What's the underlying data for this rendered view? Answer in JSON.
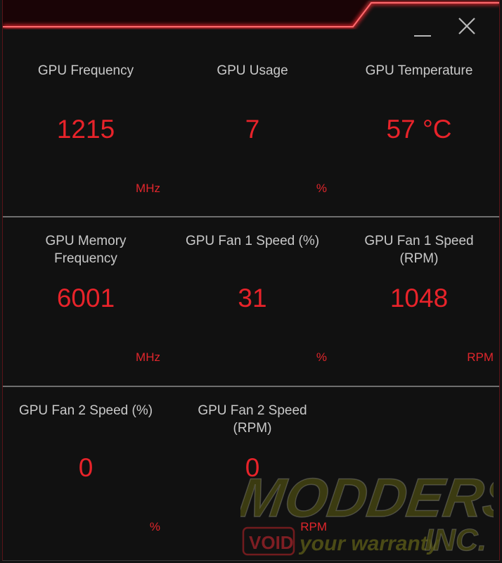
{
  "window": {
    "controls": {
      "minimize": "minimize",
      "close": "close"
    },
    "accent_color": "#e8232a"
  },
  "metrics": [
    {
      "label": "GPU Frequency",
      "value": "1215",
      "unit": "MHz"
    },
    {
      "label": "GPU Usage",
      "value": "7",
      "unit": "%"
    },
    {
      "label": "GPU Temperature",
      "value": "57 °C",
      "unit": ""
    },
    {
      "label": "GPU Memory Frequency",
      "value": "6001",
      "unit": "MHz"
    },
    {
      "label": "GPU Fan 1 Speed (%)",
      "value": "31",
      "unit": "%"
    },
    {
      "label": "GPU Fan 1 Speed (RPM)",
      "value": "1048",
      "unit": "RPM"
    },
    {
      "label": "GPU Fan 2 Speed (%)",
      "value": "0",
      "unit": "%"
    },
    {
      "label": "GPU Fan 2 Speed (RPM)",
      "value": "0",
      "unit": "RPM"
    }
  ],
  "watermark": {
    "brand_top": "MODDERS",
    "brand_inc": "INC.",
    "void": "VOID",
    "tagline": "your warranty"
  }
}
